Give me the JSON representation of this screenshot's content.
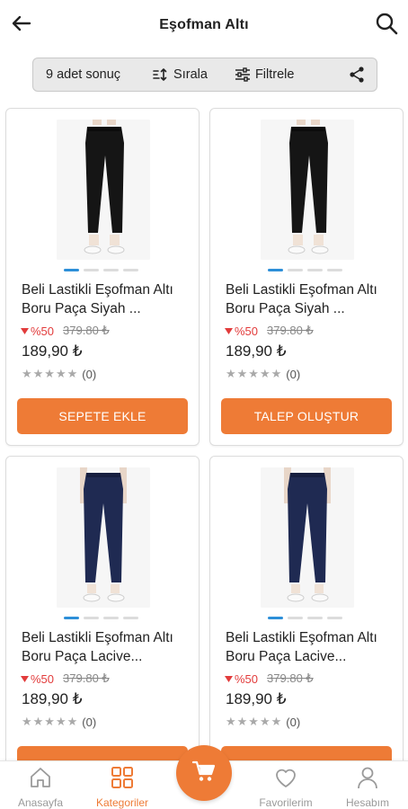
{
  "header": {
    "title": "Eşofman Altı",
    "back_icon": "arrow-left-icon",
    "search_icon": "search-icon"
  },
  "toolbar": {
    "result_count": "9 adet sonuç",
    "sort_label": "Sırala",
    "filter_label": "Filtrele",
    "share_icon": "share-icon"
  },
  "products": [
    {
      "name": "Beli Lastikli Eşofman Altı Boru Paça Siyah ...",
      "discount": "%50",
      "old_price": "379.80 ₺",
      "price": "189,90 ₺",
      "rating_count": "(0)",
      "rating_stars": "★★★★★",
      "button": "SEPETE EKLE",
      "color": "#151515"
    },
    {
      "name": "Beli Lastikli Eşofman Altı Boru Paça Siyah ...",
      "discount": "%50",
      "old_price": "379.80 ₺",
      "price": "189,90 ₺",
      "rating_count": "(0)",
      "rating_stars": "★★★★★",
      "button": "TALEP OLUŞTUR",
      "color": "#151515"
    },
    {
      "name": "Beli Lastikli Eşofman Altı Boru Paça Lacive...",
      "discount": "%50",
      "old_price": "379.80 ₺",
      "price": "189,90 ₺",
      "rating_count": "(0)",
      "rating_stars": "★★★★★",
      "button": "",
      "color": "#1f2a52"
    },
    {
      "name": "Beli Lastikli Eşofman Altı Boru Paça Lacive...",
      "discount": "%50",
      "old_price": "379.80 ₺",
      "price": "189,90 ₺",
      "rating_count": "(0)",
      "rating_stars": "★★★★★",
      "button": "",
      "color": "#1f2a52"
    }
  ],
  "bottom_nav": {
    "home": "Anasayfa",
    "categories": "Kategoriler",
    "cart_icon": "cart-icon",
    "favorites": "Favorilerim",
    "account": "Hesabım"
  },
  "colors": {
    "accent": "#ee7b36",
    "discount": "#e23b3b",
    "carousel_active": "#2d8fd8"
  }
}
